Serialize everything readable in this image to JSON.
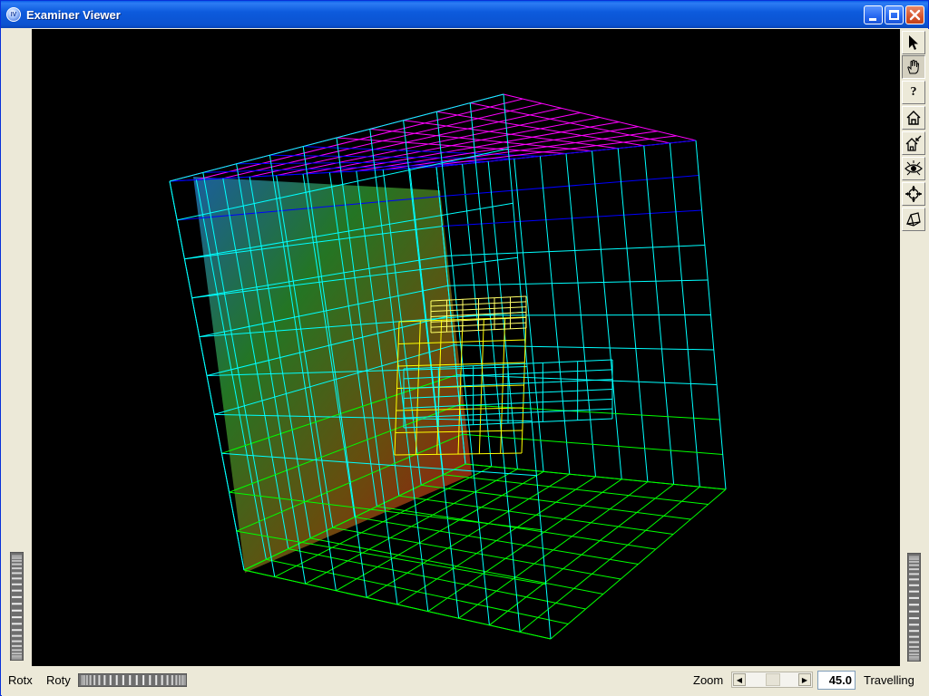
{
  "window": {
    "title": "Examiner Viewer",
    "app_icon_text": "IV"
  },
  "viewer": {
    "background_color": "#000000",
    "grid_divisions": 10,
    "wire_colors": [
      "#ff00ff",
      "#0000ff",
      "#00ffff",
      "#00ff00",
      "#ffff00",
      "#ff8800"
    ],
    "panel_gradient": [
      "#1f6fb8",
      "#2a8a2a",
      "#7a5a10",
      "#c01414"
    ]
  },
  "toolbar": {
    "items": [
      {
        "name": "pick-mode-button",
        "icon": "arrow-pointer-icon"
      },
      {
        "name": "view-mode-button",
        "icon": "hand-icon",
        "pressed": true
      },
      {
        "name": "help-button",
        "icon": "question-icon",
        "glyph": "?"
      },
      {
        "name": "home-button",
        "icon": "home-icon"
      },
      {
        "name": "set-home-button",
        "icon": "set-home-icon"
      },
      {
        "name": "view-all-button",
        "icon": "eye-icon"
      },
      {
        "name": "seek-button",
        "icon": "crosshair-icon"
      },
      {
        "name": "camera-type-button",
        "icon": "perspective-icon"
      }
    ]
  },
  "bottom": {
    "rotx_label": "Rotx",
    "roty_label": "Roty",
    "zoom_label": "Zoom",
    "zoom_value": "45.0",
    "travelling_label": "Travelling"
  }
}
